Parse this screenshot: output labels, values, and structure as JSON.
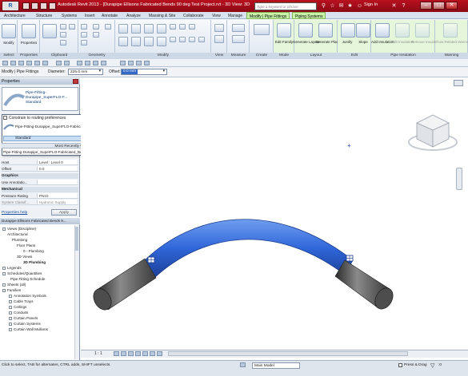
{
  "window": {
    "app_logo": "R",
    "title": "Autodesk Revit 2013 - [Durapipe Ellisons Fabricated Bends 90 deg Test Project.rvt - 3D View: 3D Plumbing]",
    "search_placeholder": "Type a keyword or phrase",
    "sign_in": "Sign In",
    "minimize": "–",
    "maximize": "□",
    "close": "✕"
  },
  "tabs": [
    {
      "label": "Architecture"
    },
    {
      "label": "Structure"
    },
    {
      "label": "Systems"
    },
    {
      "label": "Insert"
    },
    {
      "label": "Annotate"
    },
    {
      "label": "Analyze"
    },
    {
      "label": "Massing & Site"
    },
    {
      "label": "Collaborate"
    },
    {
      "label": "View"
    },
    {
      "label": "Manage"
    },
    {
      "label": "Modify | Pipe Fittings"
    },
    {
      "label": "Piping Systems"
    }
  ],
  "ribbon": {
    "modify_label": "Modify",
    "properties_label": "Properties",
    "edit_family": "Edit Family",
    "generate_layout": "Generate Layout",
    "generate_placeholder": "Generate Placeholder",
    "justify": "Justify",
    "slope": "Slope",
    "add_insulation": "Add Insulation",
    "edit_insulation": "Edit Insulation",
    "remove_insulation": "Remove Insulation",
    "show_related_warnings": "Show Related Warnings",
    "panels": {
      "select": "Select",
      "properties": "Properties",
      "clipboard": "Clipboard",
      "geometry": "Geometry",
      "modify": "Modify",
      "view": "View",
      "measure": "Measure",
      "create": "Create",
      "mode": "Mode",
      "layout": "Layout",
      "edit": "Edit",
      "pipe_insulation": "Pipe Insulation",
      "warning": "Warning"
    }
  },
  "options_bar": {
    "context": "Modify | Pipe Fittings",
    "diameter_label": "Diameter:",
    "diameter_value": "225.0 mm",
    "offset_label": "Offset:",
    "offset_value": "0.0 mm"
  },
  "properties": {
    "header": "Properties",
    "type_name": "Pipe-Fitting-Durapipe_SuperFLO-F...",
    "type_name_sub": "Standard",
    "rows": [
      {
        "label": "Host",
        "value": "Level : Level 0"
      },
      {
        "label": "Offset",
        "value": "0.0"
      }
    ],
    "graphics_section": "Graphics",
    "use_annotation_label": "Use Annotatio...",
    "mechanical_section": "Mechanical",
    "pressure_rating_label": "Pressure Rating",
    "pressure_rating_value": "PN10",
    "system_class_label": "System Classif...",
    "system_class_value": "Hydronic Supply",
    "help_link": "Properties help",
    "apply": "Apply"
  },
  "type_dropdown": {
    "constrain": "Constrain to routing preferences",
    "family_item": "Pipe-Fitting-Durapipe_SuperFLO-Fabricated_Bends_90_deg_plain",
    "standard": "Standard",
    "mru_header": "Most Recently Used Types",
    "recent_item": "Pipe-Fitting-Durapipe_SuperFLO-Fabricated_Bends_90_deg_plain : Standard"
  },
  "browser": {
    "header": "Durapipe Ellisons Fabricated Bends 9...",
    "items": [
      {
        "label": "Views (Discipline)",
        "level": 0
      },
      {
        "label": "Architectural",
        "level": 1
      },
      {
        "label": "Plumbing",
        "level": 2
      },
      {
        "label": "Floor Plans",
        "level": 3
      },
      {
        "label": "0 - Plumbing",
        "level": 4
      },
      {
        "label": "3D Views",
        "level": 3
      },
      {
        "label": "3D Plumbing",
        "level": 4
      },
      {
        "label": "Legends",
        "level": 0
      },
      {
        "label": "Schedules/Quantities",
        "level": 0
      },
      {
        "label": "Pipe Fitting Schedule",
        "level": 1
      },
      {
        "label": "Sheets (all)",
        "level": 0
      },
      {
        "label": "Families",
        "level": 0
      },
      {
        "label": "Annotation Symbols",
        "level": 1
      },
      {
        "label": "Cable Trays",
        "level": 1
      },
      {
        "label": "Ceilings",
        "level": 1
      },
      {
        "label": "Conduits",
        "level": 1
      },
      {
        "label": "Curtain Panels",
        "level": 1
      },
      {
        "label": "Curtain Systems",
        "level": 1
      },
      {
        "label": "Curtain Wall Mullions",
        "level": 1
      }
    ]
  },
  "view_controls": {
    "scale": "1 : 1"
  },
  "status": {
    "hint": "Click to select, TAB for alternates, CTRL adds, SHIFT unselects.",
    "model": "Main Model",
    "press_drag": "Press & Drag",
    "count": ":0"
  }
}
